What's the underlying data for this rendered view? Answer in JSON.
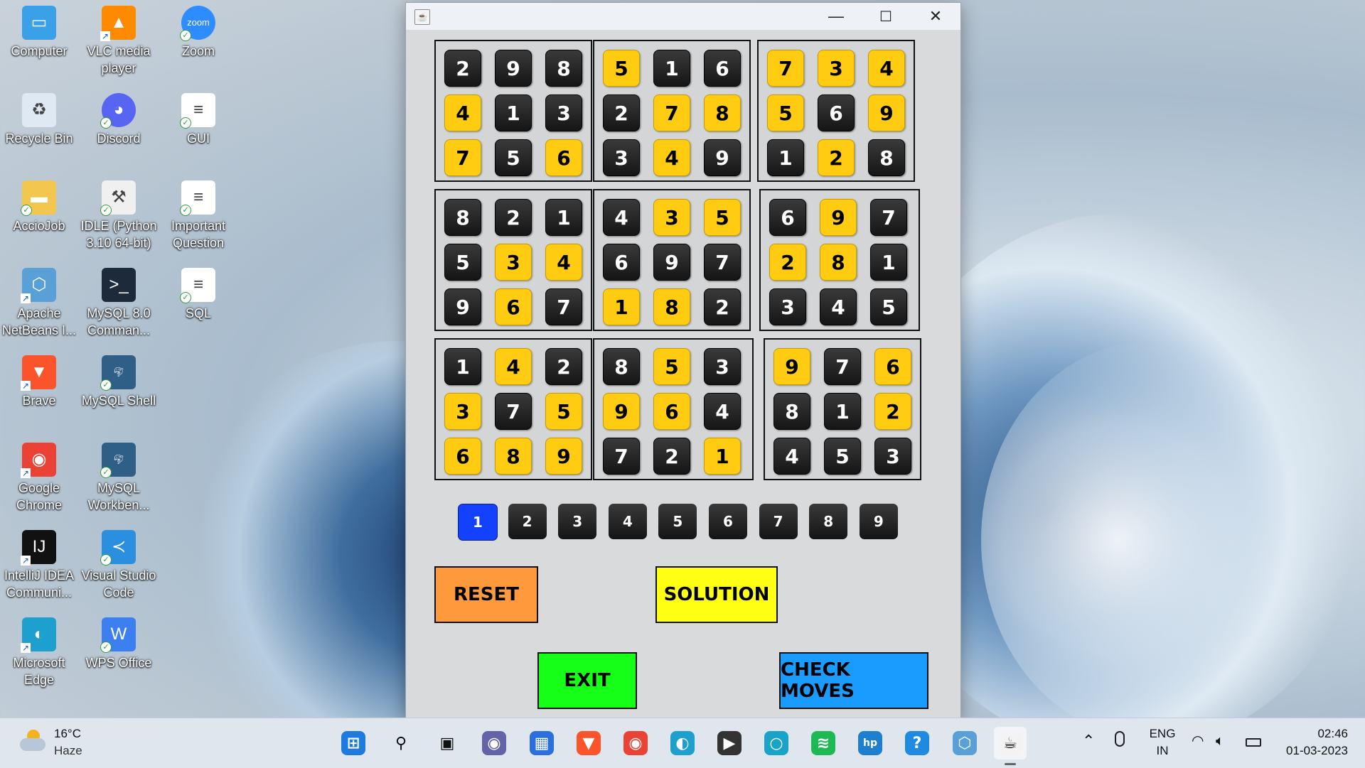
{
  "desktop": {
    "icons": [
      {
        "label": "Computer",
        "icon": "computer-icon"
      },
      {
        "label": "VLC media player",
        "icon": "vlc-icon"
      },
      {
        "label": "Zoom",
        "icon": "zoom-icon"
      },
      {
        "label": "Recycle Bin",
        "icon": "recycle-bin-icon"
      },
      {
        "label": "Discord",
        "icon": "discord-icon"
      },
      {
        "label": "GUI",
        "icon": "document-icon"
      },
      {
        "label": "AccioJob",
        "icon": "folder-icon"
      },
      {
        "label": "IDLE (Python 3.10 64-bit)",
        "icon": "python-idle-icon"
      },
      {
        "label": "Important Question",
        "icon": "document-icon"
      },
      {
        "label": "Apache NetBeans I...",
        "icon": "netbeans-icon"
      },
      {
        "label": "MySQL 8.0 Comman...",
        "icon": "mysql-cli-icon"
      },
      {
        "label": "SQL",
        "icon": "document-icon"
      },
      {
        "label": "Brave",
        "icon": "brave-icon"
      },
      {
        "label": "MySQL Shell",
        "icon": "mysql-shell-icon"
      },
      {
        "label": "Google Chrome",
        "icon": "chrome-icon"
      },
      {
        "label": "MySQL Workben...",
        "icon": "mysql-workbench-icon"
      },
      {
        "label": "IntelliJ IDEA Communi...",
        "icon": "intellij-icon"
      },
      {
        "label": "Visual Studio Code",
        "icon": "vscode-icon"
      },
      {
        "label": "Microsoft Edge",
        "icon": "edge-icon"
      },
      {
        "label": "WPS Office",
        "icon": "wps-icon"
      }
    ]
  },
  "window": {
    "title_icon": "java-app-icon",
    "controls": {
      "minimize": "—",
      "maximize": "☐",
      "close": "✕"
    }
  },
  "sudoku": {
    "colors": {
      "black": "#1e1e1e",
      "yellow": "#ffcc12",
      "selected": "#1441ff"
    },
    "blocks": [
      [
        [
          "2",
          "b"
        ],
        [
          "9",
          "b"
        ],
        [
          "8",
          "b"
        ],
        [
          "4",
          "y"
        ],
        [
          "1",
          "b"
        ],
        [
          "3",
          "b"
        ],
        [
          "7",
          "y"
        ],
        [
          "5",
          "b"
        ],
        [
          "6",
          "y"
        ]
      ],
      [
        [
          "5",
          "y"
        ],
        [
          "1",
          "b"
        ],
        [
          "6",
          "b"
        ],
        [
          "2",
          "b"
        ],
        [
          "7",
          "y"
        ],
        [
          "8",
          "y"
        ],
        [
          "3",
          "b"
        ],
        [
          "4",
          "y"
        ],
        [
          "9",
          "b"
        ]
      ],
      [
        [
          "7",
          "y"
        ],
        [
          "3",
          "y"
        ],
        [
          "4",
          "y"
        ],
        [
          "5",
          "y"
        ],
        [
          "6",
          "b"
        ],
        [
          "9",
          "y"
        ],
        [
          "1",
          "b"
        ],
        [
          "2",
          "y"
        ],
        [
          "8",
          "b"
        ]
      ],
      [
        [
          "8",
          "b"
        ],
        [
          "2",
          "b"
        ],
        [
          "1",
          "b"
        ],
        [
          "5",
          "b"
        ],
        [
          "3",
          "y"
        ],
        [
          "4",
          "y"
        ],
        [
          "9",
          "b"
        ],
        [
          "6",
          "y"
        ],
        [
          "7",
          "b"
        ]
      ],
      [
        [
          "4",
          "b"
        ],
        [
          "3",
          "y"
        ],
        [
          "5",
          "y"
        ],
        [
          "6",
          "b"
        ],
        [
          "9",
          "b"
        ],
        [
          "7",
          "b"
        ],
        [
          "1",
          "y"
        ],
        [
          "8",
          "y"
        ],
        [
          "2",
          "b"
        ]
      ],
      [
        [
          "6",
          "b"
        ],
        [
          "9",
          "y"
        ],
        [
          "7",
          "b"
        ],
        [
          "2",
          "y"
        ],
        [
          "8",
          "y"
        ],
        [
          "1",
          "b"
        ],
        [
          "3",
          "b"
        ],
        [
          "4",
          "b"
        ],
        [
          "5",
          "b"
        ]
      ],
      [
        [
          "1",
          "b"
        ],
        [
          "4",
          "y"
        ],
        [
          "2",
          "b"
        ],
        [
          "3",
          "y"
        ],
        [
          "7",
          "b"
        ],
        [
          "5",
          "y"
        ],
        [
          "6",
          "y"
        ],
        [
          "8",
          "y"
        ],
        [
          "9",
          "y"
        ]
      ],
      [
        [
          "8",
          "b"
        ],
        [
          "5",
          "y"
        ],
        [
          "3",
          "b"
        ],
        [
          "9",
          "y"
        ],
        [
          "6",
          "y"
        ],
        [
          "4",
          "b"
        ],
        [
          "7",
          "b"
        ],
        [
          "2",
          "b"
        ],
        [
          "1",
          "y"
        ]
      ],
      [
        [
          "9",
          "y"
        ],
        [
          "7",
          "b"
        ],
        [
          "6",
          "y"
        ],
        [
          "8",
          "b"
        ],
        [
          "1",
          "b"
        ],
        [
          "2",
          "y"
        ],
        [
          "4",
          "b"
        ],
        [
          "5",
          "b"
        ],
        [
          "3",
          "b"
        ]
      ]
    ],
    "number_buttons": [
      "1",
      "2",
      "3",
      "4",
      "5",
      "6",
      "7",
      "8",
      "9"
    ],
    "selected_number": "1",
    "actions": {
      "reset": "RESET",
      "solution": "SOLUTION",
      "exit": "EXIT",
      "check_moves": "CHECK MOVES"
    },
    "action_colors": {
      "reset": "#ff9a3c",
      "solution": "#ffff14",
      "exit": "#16ff16",
      "check_moves": "#1a9cff"
    }
  },
  "taskbar": {
    "weather": {
      "temp": "16°C",
      "condition": "Haze",
      "icon": "weather-cloud-sun-icon"
    },
    "apps": [
      "start-icon",
      "search-icon",
      "task-view-icon",
      "teams-chat-icon",
      "store-icon",
      "brave-icon",
      "chrome-icon",
      "edge-icon",
      "media-player-icon",
      "cortana-icon",
      "spotify-icon",
      "myhp-icon",
      "help-icon",
      "netbeans-icon",
      "java-icon"
    ],
    "tray": {
      "lang_line1": "ENG",
      "lang_line2": "IN",
      "time": "02:46",
      "date": "01-03-2023"
    }
  }
}
